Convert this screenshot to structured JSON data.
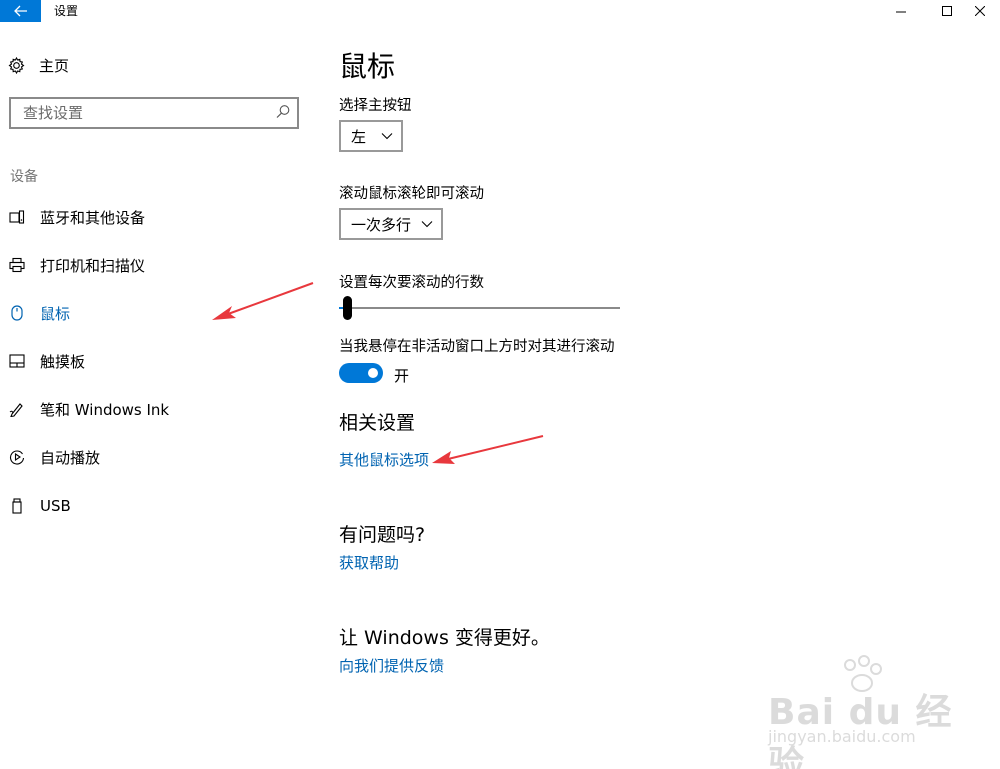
{
  "titlebar": {
    "title": "设置"
  },
  "sidebar": {
    "home_label": "主页",
    "search_placeholder": "查找设置",
    "section_label": "设备",
    "items": [
      {
        "label": "蓝牙和其他设备",
        "icon": "bluetooth-device-icon"
      },
      {
        "label": "打印机和扫描仪",
        "icon": "printer-icon"
      },
      {
        "label": "鼠标",
        "icon": "mouse-icon",
        "active": true
      },
      {
        "label": "触摸板",
        "icon": "touchpad-icon"
      },
      {
        "label": "笔和 Windows Ink",
        "icon": "pen-icon"
      },
      {
        "label": "自动播放",
        "icon": "autoplay-icon"
      },
      {
        "label": "USB",
        "icon": "usb-icon"
      }
    ]
  },
  "main": {
    "title": "鼠标",
    "primary_button_label": "选择主按钮",
    "primary_button_value": "左",
    "scroll_label": "滚动鼠标滚轮即可滚动",
    "scroll_value": "一次多行",
    "lines_label": "设置每次要滚动的行数",
    "lines_slider_fraction": 0.03,
    "inactive_scroll_label": "当我悬停在非活动窗口上方时对其进行滚动",
    "inactive_scroll_state": "开",
    "related_heading": "相关设置",
    "related_link": "其他鼠标选项",
    "question_heading": "有问题吗?",
    "help_link": "获取帮助",
    "feedback_heading": "让 Windows 变得更好。",
    "feedback_link": "向我们提供反馈"
  },
  "watermark": {
    "brand": "Bai du 经验",
    "url": "jingyan.baidu.com"
  },
  "colors": {
    "accent": "#0078d7",
    "link": "#0063b1",
    "annotation_arrow": "#e8383d"
  }
}
